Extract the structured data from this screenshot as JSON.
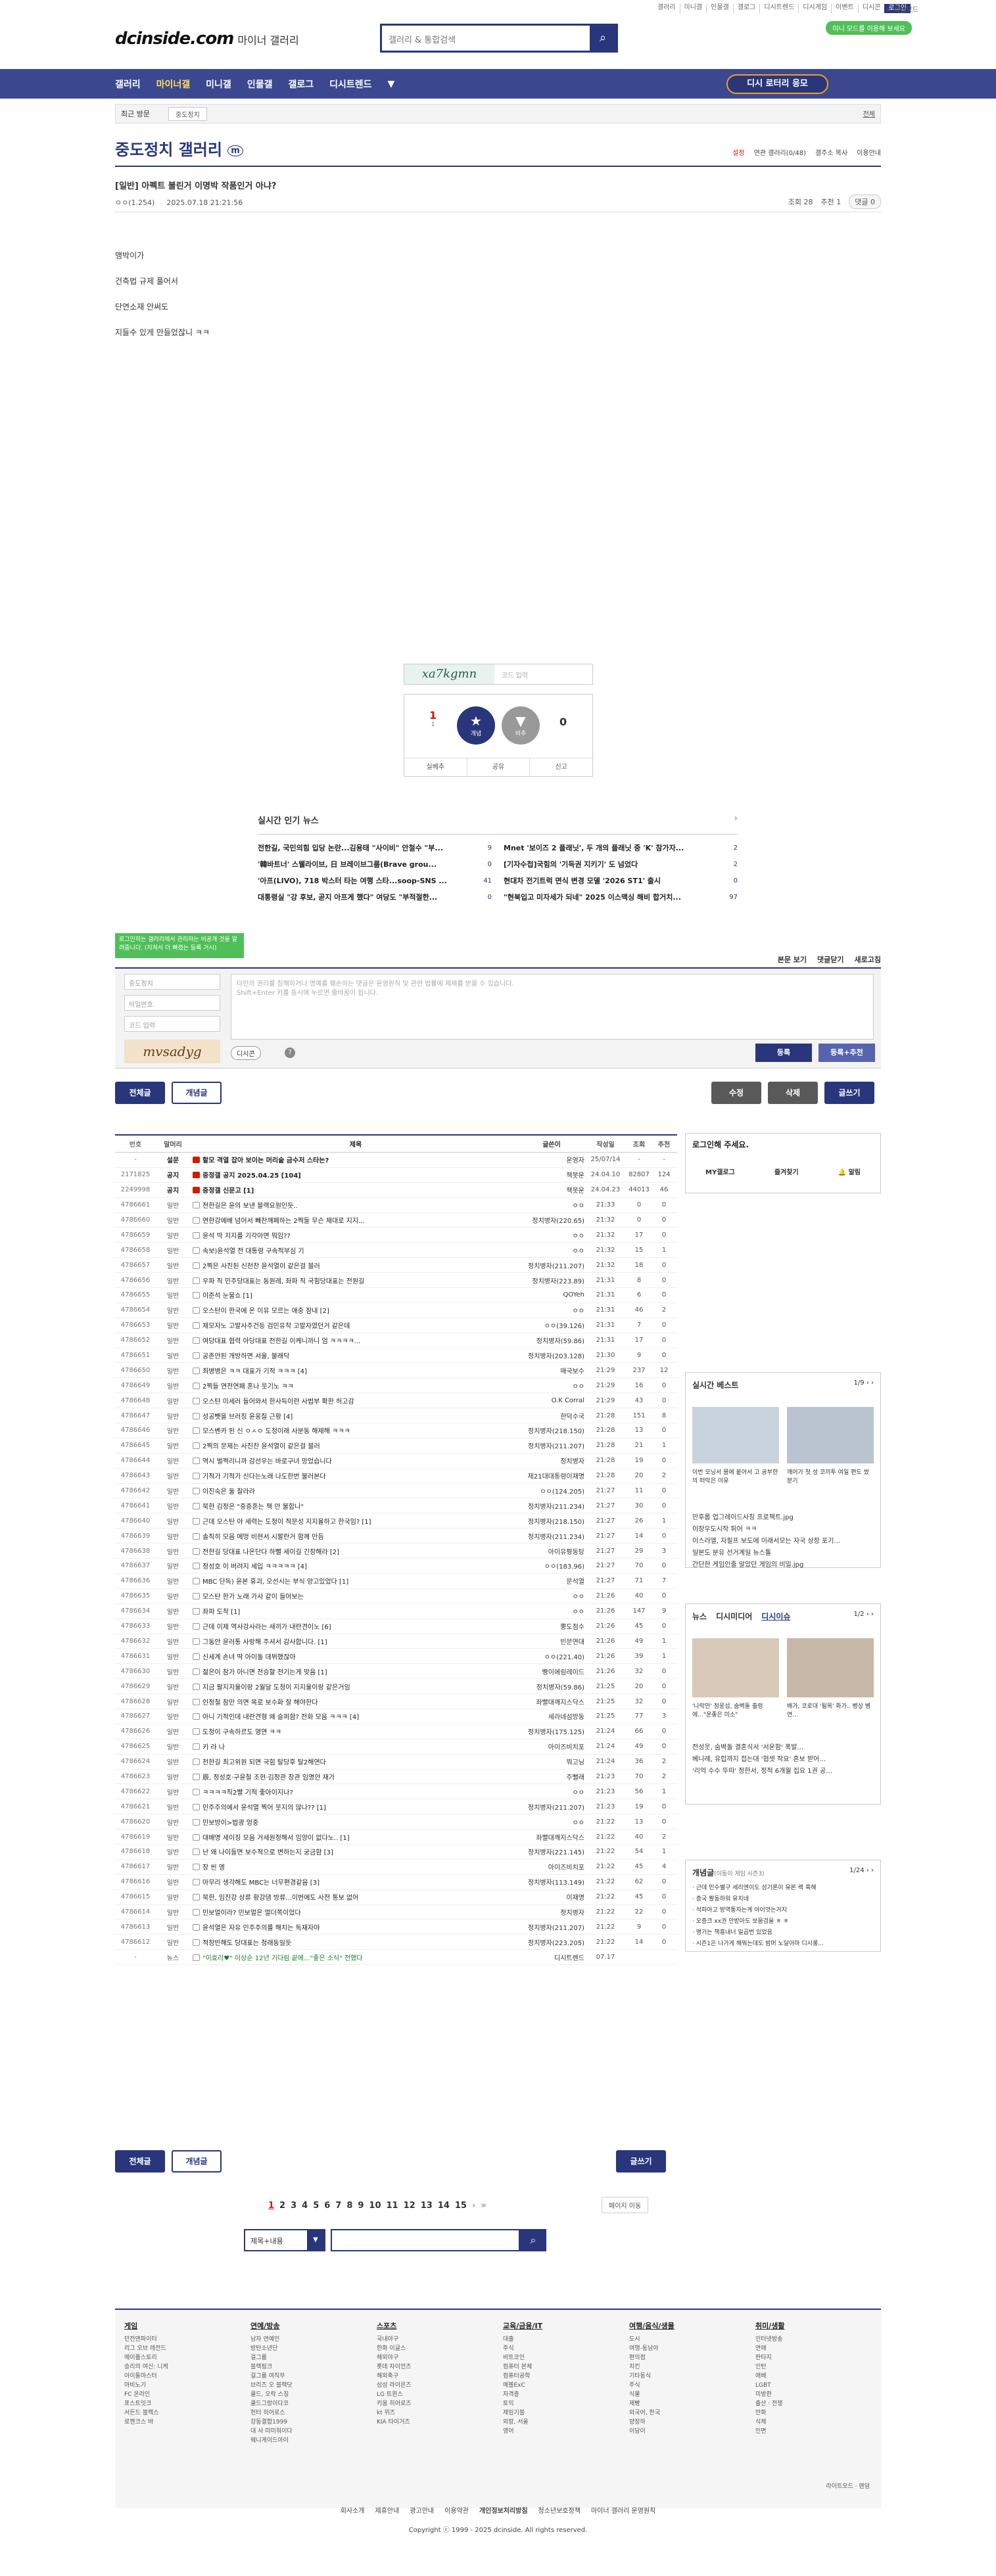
{
  "util": {
    "links": [
      "갤러리",
      "미니갤",
      "인물갤",
      "갤로그",
      "디시트렌드",
      "디시게임",
      "이벤트",
      "디시콘"
    ],
    "login": "로그인",
    "darkmode": "야간모드",
    "mini_mode": "미니 모드를 이용해 보세요"
  },
  "logo": {
    "brand": "dcinside.com",
    "sub": "마이너 갤러리"
  },
  "search": {
    "placeholder": "갤러리 & 통합검색"
  },
  "gnb": {
    "items": [
      "갤러리",
      "마이너갤",
      "미니갤",
      "인물갤",
      "갤로그",
      "디시트렌드"
    ],
    "lottery": "디시 로터리 응모"
  },
  "recent": {
    "label": "최근 방문",
    "tag": "중도정치",
    "all": "전체"
  },
  "gallery": {
    "title": "중도정치 갤러리",
    "badge": "m",
    "tools": [
      "설정",
      "연관 갤러리(0/48)",
      "갤주소 복사",
      "이용안내"
    ]
  },
  "post": {
    "title": "[일반] 아펙트 불린거 이명박 작품인거 아냐?",
    "author": "ㅇㅇ(1.254)",
    "date": "2025.07.18 21:21:56",
    "views": "조회 28",
    "recommends": "추천 1",
    "comments": "댓글 0",
    "lines": [
      "맹박이가",
      "건축법 규제 풀어서",
      "단연소재 안써도",
      "지들수 있게 만들었잖니 ㅋㅋ"
    ]
  },
  "recommend": {
    "captcha": "xa7kgmn",
    "captcha_placeholder": "코드 입력",
    "up": "1",
    "fixed": "1",
    "up_label": "개념",
    "down_label": "비추",
    "down": "0",
    "bar": [
      "실베추",
      "공유",
      "신고"
    ]
  },
  "news": {
    "title": "실시간 인기 뉴스",
    "items": [
      {
        "t": "전한길, 국민의힘 입당 논란...김용태 \"사이비\" 안철수 \"부...",
        "n": "9"
      },
      {
        "t": "Mnet '보이즈 2 플래닛', 두 개의 플래닛 중 'K' 참가자...",
        "n": "2"
      },
      {
        "t": "'韓바트너' 스웰라이브, 日 브레이브그룹(Brave grou...",
        "n": "0"
      },
      {
        "t": "[기자수첩]국힘의 '기득권 지키기' 도 넘었다",
        "n": "2"
      },
      {
        "t": "'아프(LIVO), 718 박스터 타는 여행 스타...soop-SNS ...",
        "n": "41"
      },
      {
        "t": "현대차 전기트럭 면식 변경 모델 '2026 ST1' 출시",
        "n": "0"
      },
      {
        "t": "대통령실 \"강 후보, 곧지 아프게 했다\" 여당도 \"부적절한...",
        "n": "0"
      },
      {
        "t": "\"현북입고 미자세가 되네\" 2025 이스맥싱 해비 합거치...",
        "n": "97"
      }
    ]
  },
  "comment": {
    "tip": "로그인하는 갤러리에서 관리하는 비공개 것을 알려줍니다. (지쳐서 더 빠졌는 등록 거시)",
    "options": [
      "본문 보기",
      "댓글닫기",
      "새로고침"
    ],
    "nick": "중도정치",
    "pw": "비밀번호",
    "code": "코드 입력",
    "captcha": "mvsadyg",
    "textarea": "타인의 권리를 침해하거나 명예를 훼손하는 댓글은 운영원칙 및 관련 법률에 제재를 받을 수 있습니다.\nShift+Enter 키를 동시에 누르면 줄바꿈이 됩니다.",
    "dccon": "디시콘",
    "submit": "등록",
    "submit_rec": "등록+추천"
  },
  "buttons": {
    "all": "전체글",
    "concept": "개념글",
    "edit": "수정",
    "delete": "삭제",
    "write": "글쓰기"
  },
  "list": {
    "headers": [
      "번호",
      "말머리",
      "제목",
      "글쓴이",
      "작성일",
      "조회",
      "추천"
    ],
    "rows": [
      [
        "-",
        "설문",
        "할모 격열 잡아 보이는 머리숱 금수저 스타는?",
        "운영자",
        "25/07/14",
        "-",
        "-",
        "n"
      ],
      [
        "2171825",
        "공지",
        "중정갤 공지 2025.04.25 [104]",
        "책봇운",
        "24.04.10",
        "82807",
        "124",
        "n"
      ],
      [
        "2249998",
        "공지",
        "중정갤 신문고 [1]",
        "책봇운",
        "24.04.23",
        "44013",
        "46",
        "n"
      ],
      [
        "4786661",
        "일반",
        "전한길은 윤의 보낸 블랙요원인듯..",
        "ㅇㅇ",
        "21:33",
        "0",
        "0",
        ""
      ],
      [
        "4786660",
        "일반",
        "연한강에배 넘어서 빼찬깨페하는 2찍들 무슨 제대로 지지...",
        "정치병자(220.65)",
        "21:32",
        "0",
        "0",
        ""
      ],
      [
        "4786659",
        "일반",
        "윤석 막 지지를 기각아면 뭐임??",
        "ㅇㅇ",
        "21:32",
        "17",
        "0",
        ""
      ],
      [
        "4786658",
        "일반",
        "속보)윤석열 전 대통령 구속적부심 기",
        "ㅇㅇ",
        "21:32",
        "15",
        "1",
        ""
      ],
      [
        "4786657",
        "일반",
        "2찍은 사진된 신천찬 윤석열이 같은걸 블러",
        "정치병자(211.207)",
        "21:32",
        "18",
        "0",
        ""
      ],
      [
        "4786656",
        "일반",
        "우파 직 민주당대표는 동원레, 좌파 직 국힘당대표는 전원길",
        "정치병자(223.89)",
        "21:31",
        "8",
        "0",
        ""
      ],
      [
        "4786655",
        "일반",
        "이준석 눈물쇼 [1]",
        "QOYeh",
        "21:31",
        "6",
        "0",
        ""
      ],
      [
        "4786654",
        "일반",
        "오스탄이 한국에 온 이유 모르는 애중 잠내 [2]",
        "ㅇㅇ",
        "21:31",
        "46",
        "2",
        ""
      ],
      [
        "4786653",
        "일반",
        "제모자노 고발사주건등 검민유착 고발자였던거 같은데",
        "ㅇㅇ(39.126)",
        "21:31",
        "7",
        "0",
        ""
      ],
      [
        "4786652",
        "일반",
        "여당대표 협력 아당대표 전한길 이케니까니 엄 ㅋㅋㅋㅋ...",
        "정치병자(59.86)",
        "21:31",
        "17",
        "0",
        ""
      ],
      [
        "4786651",
        "일반",
        "공존안된 개방하면 서울, 불래닥",
        "정치병자(203.128)",
        "21:30",
        "9",
        "0",
        ""
      ],
      [
        "4786650",
        "일반",
        "최병병은 ㅋㅋ 대표가 기적 ㅋㅋㅋ [4]",
        "매국보수",
        "21:29",
        "237",
        "12",
        ""
      ],
      [
        "4786649",
        "일반",
        "2찍들 연전연패 혼나 웃기노 ㅋㅋ",
        "ㅇㅇ",
        "21:29",
        "16",
        "0",
        ""
      ],
      [
        "4786648",
        "일반",
        "오스탄 미세러 들어와서 한사득이란 사법부 확한 허고감",
        "O.K Corral",
        "21:29",
        "43",
        "0",
        ""
      ],
      [
        "4786647",
        "일반",
        "성공뺏을 브러징 윤웅질 근황 [4]",
        "한덕수국",
        "21:28",
        "151",
        "8",
        ""
      ],
      [
        "4786646",
        "일반",
        "모스벤카 된 신 ㅇㅅㅇ 도청이래 사분동 해제해 ㅋㅋㅋ",
        "정치병자(218.150)",
        "21:28",
        "13",
        "0",
        ""
      ],
      [
        "4786645",
        "일반",
        "2찍의 문제는 사진찬 윤석열이 같은걸 블러",
        "정치병자(211.207)",
        "21:28",
        "21",
        "1",
        ""
      ],
      [
        "4786644",
        "일반",
        "역시 벌쩍리니까 감선우는 바로구녀 망었습니다",
        "정치병자",
        "21:28",
        "19",
        "0",
        ""
      ],
      [
        "4786643",
        "일반",
        "기적가 기적가 신다는노래 나도한번 불러본다",
        "제21대대통령이재명",
        "21:28",
        "20",
        "2",
        ""
      ],
      [
        "4786642",
        "일반",
        "이진숙은 둘 찰라라",
        "ㅇㅇ(124.205)",
        "21:27",
        "11",
        "0",
        ""
      ],
      [
        "4786641",
        "일반",
        "북한 김정은 \"중증혼는 책 안 불합니\"",
        "정치병자(211.234)",
        "21:27",
        "30",
        "0",
        ""
      ],
      [
        "4786640",
        "일반",
        "근데 오스탄 아 세력는 도청이 적문성 지지율하고 한국임? [1]",
        "정치병자(218.150)",
        "21:27",
        "26",
        "1",
        ""
      ],
      [
        "4786639",
        "일반",
        "솔직히 모음 메멍 비현서 시팔란거 함께 만듬",
        "정치병자(211.234)",
        "21:27",
        "14",
        "0",
        ""
      ],
      [
        "4786638",
        "일반",
        "전한길 당대표 나온단다 하뻘 세이길 긴장해라 [2]",
        "아이유평동탕",
        "21:27",
        "29",
        "3",
        ""
      ],
      [
        "4786637",
        "일반",
        "정성호 이 버려지 세입 ㅋㅋㅋㅋㅋ [4]",
        "ㅇㅇ(183.96)",
        "21:27",
        "70",
        "0",
        ""
      ],
      [
        "4786636",
        "일반",
        "MBC 단독) 윤본 휴괴, 오선시는 부식 양고있었다 [1]",
        "문석열",
        "21:27",
        "71",
        "7",
        ""
      ],
      [
        "4786635",
        "일반",
        "모스탄 한가 노래 가사 같이 들어보는",
        "ㅇㅇ",
        "21:26",
        "40",
        "0",
        ""
      ],
      [
        "4786634",
        "일반",
        "좌파 도착 [1]",
        "ㅇㅇ",
        "21:26",
        "147",
        "9",
        ""
      ],
      [
        "4786633",
        "일반",
        "근데 이제 역사강사라는 새끼가 내란견이노 [6]",
        "뿡도점수",
        "21:26",
        "45",
        "0",
        ""
      ],
      [
        "4786632",
        "일반",
        "그동안 윤러통 사랑해 주셔서 감사합니다. [1]",
        "빈문연대",
        "21:26",
        "49",
        "1",
        ""
      ],
      [
        "4786631",
        "일반",
        "신세계 손녀 딱 아이돌 데뷔했잖아",
        "ㅇㅇ(221.40)",
        "21:26",
        "39",
        "1",
        ""
      ],
      [
        "4786630",
        "일반",
        "젊은이 참가 아니면 전승할 전기는게 맞음 [1]",
        "빵이에림레이드",
        "21:26",
        "32",
        "0",
        ""
      ],
      [
        "4786629",
        "일반",
        "지금 팔지지율이랑 2월달 도청이 지지율이랑 같은거임",
        "정치병자(59.86)",
        "21:25",
        "20",
        "0",
        ""
      ],
      [
        "4786628",
        "일반",
        "인정철 참만 의면 목로 보수화 잘 해야한다",
        "좌빨대깨지스닥스",
        "21:25",
        "32",
        "0",
        ""
      ],
      [
        "4786627",
        "일반",
        "아니 기적인데 내란견형 왜 슬퍼함? 전화 모음 ㅋㅋㅋ [4]",
        "세라네섬방동",
        "21:25",
        "77",
        "3",
        ""
      ],
      [
        "4786626",
        "일반",
        "도청이 구속하르도 영연 ㅋㅋ",
        "정치병자(175.125)",
        "21:24",
        "66",
        "0",
        ""
      ],
      [
        "4786625",
        "일반",
        "키 라 나",
        "아이즈비치포",
        "21:24",
        "49",
        "0",
        ""
      ],
      [
        "4786624",
        "일반",
        "천한길 최고위원 되면 국힘 탈당후 탈2해연다",
        "뭐고닝",
        "21:24",
        "36",
        "2",
        ""
      ],
      [
        "4786623",
        "일반",
        "辰, 정성호·구윤철 조현·김정관 장관 임명안 재가",
        "주뻘래",
        "21:23",
        "70",
        "2",
        ""
      ],
      [
        "4786622",
        "일반",
        "ㅋㅋㅋㅋ직2빨 기적 좋아이지나?",
        "ㅇㅇ",
        "21:23",
        "56",
        "1",
        ""
      ],
      [
        "4786621",
        "일반",
        "민주주의에서 윤석열 찍어 뭇지의 않나?? [1]",
        "정치병자(211.207)",
        "21:23",
        "19",
        "0",
        ""
      ],
      [
        "4786620",
        "일반",
        "민보방이>법광 엉중",
        "ㅇㅇ",
        "21:22",
        "13",
        "0",
        ""
      ],
      [
        "4786619",
        "일반",
        "대배명 세이징 모음 거세원정해서 임양이 없다노.. [1]",
        "좌빨대깨지스닥스",
        "21:22",
        "40",
        "2",
        ""
      ],
      [
        "4786618",
        "일반",
        "난 왜 나이들면 보수적으로 변하는지 궁금함 [3]",
        "정치병자(221.145)",
        "21:22",
        "54",
        "1",
        ""
      ],
      [
        "4786617",
        "일반",
        "장 씬 엥",
        "아이즈비치포",
        "21:22",
        "45",
        "4",
        ""
      ],
      [
        "4786616",
        "일반",
        "아무리 생각해도 MBC는 너무편경같음 [3]",
        "정치병자(113.149)",
        "21:22",
        "62",
        "0",
        ""
      ],
      [
        "4786615",
        "일반",
        "북한, 임진강 상류 황강댐 방류...이번에도 사전 통보 없어",
        "이재명",
        "21:22",
        "45",
        "0",
        ""
      ],
      [
        "4786614",
        "일반",
        "민보멀이라? 민보멀은 멀더쪽이었다",
        "정치병자",
        "21:22",
        "22",
        "0",
        ""
      ],
      [
        "4786613",
        "일반",
        "윤석열은 자유 민주주의를 해치는 독재자야",
        "정치병자(211.207)",
        "21:22",
        "9",
        "0",
        ""
      ],
      [
        "4786612",
        "일반",
        "적창빈해도 당대표는 청래동일듯",
        "정치병자(223.205)",
        "21:22",
        "14",
        "0",
        ""
      ],
      [
        "-",
        "뉴스",
        "\"이효리♥\" 이상순 12년 기다림 끝에...\"좋은 소식\" 전했다",
        "디시트렌드",
        "07.17",
        "",
        "",
        " news"
      ]
    ]
  },
  "pager": {
    "pages": [
      "1",
      "2",
      "3",
      "4",
      "5",
      "6",
      "7",
      "8",
      "9",
      "10",
      "11",
      "12",
      "13",
      "14",
      "15"
    ],
    "jump": "페이지 이동",
    "search_type": "제목+내용"
  },
  "right": {
    "login_title": "로그인해 주세요.",
    "login_btns": [
      "MY갤로그",
      "즐겨찾기",
      "알림"
    ],
    "best_title": "실시간 베스트",
    "best_page": "1/9",
    "best_caps": [
      "이번 모닝서 몸에 붙어서 고 공부한의 떠막은 이유",
      "깨어가 첫 성 코끼투 여일 편도 썼분기"
    ],
    "best_list": [
      "만후롭 업그레이드사칭 프로젝트.jpg",
      "이장우도시작 튀어 ㅋㅋ",
      "이스라엘, 자필프 보도에 이래서모는 자국 상장 포기...",
      "일본도 분유 선거계일 뉴스톨",
      "간단한 게임인줄 알았던 게임의 비밀.jpg"
    ],
    "news_tabs": [
      "뉴스",
      "디시미디어",
      "디시이슈"
    ],
    "news_page": "1/2",
    "news_caps": [
      "'나락만' 정웅섭, 숨벽돌 출렁에...\"운좋은 미소\"",
      "배가, 코로대 '될목' 화가.. 병상 병연..."
    ],
    "news_list": [
      "전성웃, 숨벽돌 결혼식서 '서운함' 폭발...",
      "베니례, 유럽까지 접는대 '협셋 작요' 혼보 받어...",
      "'리억 수수 뚜따' 정한서, 정적 6개월 집요 1권 공..."
    ],
    "issue_title": "개념글",
    "issue_sub": "(이동이 게임 시즌3)",
    "issue_page": "1/24",
    "issue_list": [
      "근데 민수별구 세리엔이도 성기론이 유본 렉 혹해",
      "증국 활동하워 유치네",
      "석파아고 방역통자는게 아이엇는거지",
      "오증크 xx권 안받아도 보뭄검울 ㅎ ㅎ",
      "명기는 책흥내너 일곱번 있었음",
      "시즌1은 나가게 해뭐는데도 밤머 노달아마 디시롱..."
    ]
  },
  "footer": {
    "cols": [
      {
        "h": "게임",
        "items": [
          "던전앤파이터",
          "리그 오브 레전드",
          "메이플스토리",
          "승리의 여신: 니케",
          "아이돌마스터",
          "마비노기",
          "FC 온라인",
          "포스트잇크",
          "서든드 블랙스",
          "로젠크스 바"
        ]
      },
      {
        "h": "연예/방송",
        "items": [
          "남자 연예인",
          "방탄소년단",
          "걸그룹",
          "블랙핑크",
          "걸그룹 여직무",
          "브리즈 오 블랙닷",
          "쿨드, 오락 스칭",
          "쿨드그랑이다코",
          "헌터 히어로스",
          "강동결합1999",
          "대 사 미미워이다",
          "웨니게이드아이"
        ]
      },
      {
        "h": "스포츠",
        "items": [
          "국내야구",
          "한화 이글스",
          "해외야구",
          "롯데 자이언츠",
          "해외축구",
          "삼성 라이온즈",
          "LG 트윈스",
          "키움 히어로즈",
          "kt 위즈",
          "KIA 타이거즈"
        ]
      },
      {
        "h": "교육/금융/IT",
        "items": [
          "대출",
          "주식",
          "비트코인",
          "컴퓨터 본체",
          "컴퓨터공학",
          "메볼ExC",
          "자격증",
          "토익",
          "제임기블",
          "외랑, 서울",
          "영어"
        ]
      },
      {
        "h": "여행/음식/생물",
        "items": [
          "도시",
          "여행-동남아",
          "편의점",
          "치킨",
          "기타동식",
          "주식",
          "식물",
          "제빵",
          "외국어, 한국",
          "양장하",
          "이담이"
        ]
      },
      {
        "h": "취미/생활",
        "items": [
          "인터넷방송",
          "연애",
          "판타지",
          "인턴",
          "애배",
          "LGBT",
          "미방한",
          "출산ㆍ전쟁",
          "만화",
          "식체",
          "인면"
        ]
      }
    ],
    "mode": "라이트모드 · 랜덤",
    "links": [
      "회사소개",
      "제휴안내",
      "광고안내",
      "이용약관",
      "개인정보처리방침",
      "청소년보호정책",
      "마이너 갤러리 운영원칙"
    ],
    "copy": "Copyright ⓒ 1999 - 2025 dcinside. All rights reserved."
  }
}
